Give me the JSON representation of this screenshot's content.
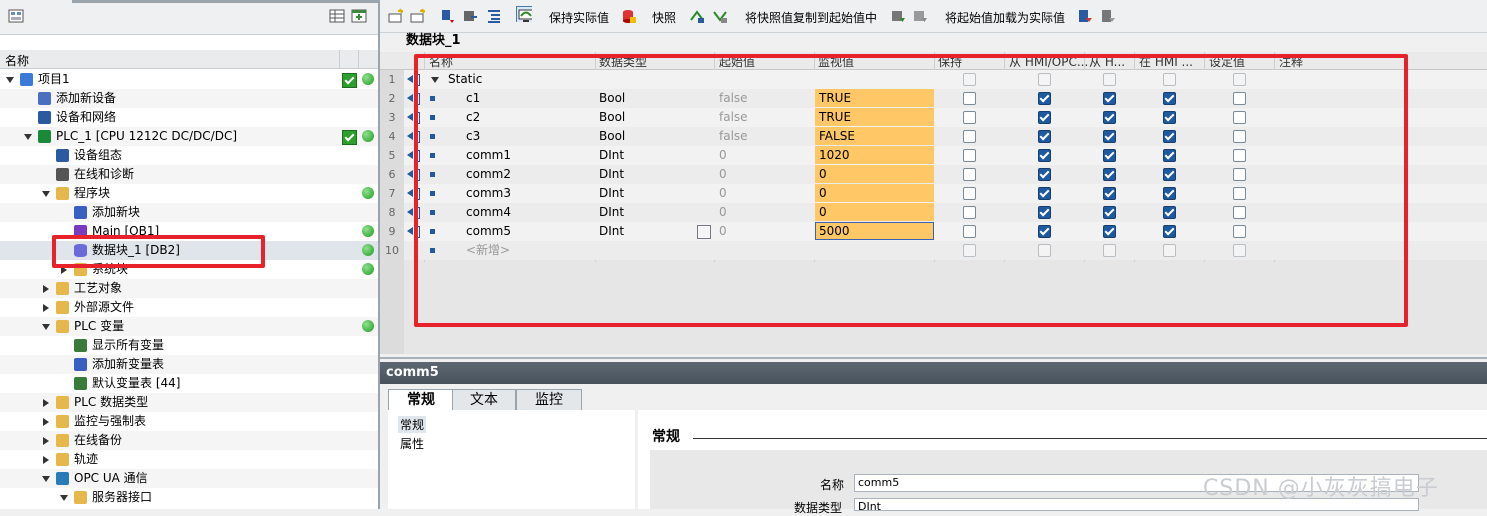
{
  "left_panel": {
    "header": "名称",
    "tree": [
      {
        "label": "项目1",
        "indent": 0,
        "expand": "down",
        "icon": "project-icon",
        "check": true,
        "dot": true
      },
      {
        "label": "添加新设备",
        "indent": 1,
        "expand": "",
        "icon": "add-device-icon",
        "check": false,
        "dot": false
      },
      {
        "label": "设备和网络",
        "indent": 1,
        "expand": "",
        "icon": "network-icon",
        "check": false,
        "dot": false
      },
      {
        "label": "PLC_1 [CPU 1212C DC/DC/DC]",
        "indent": 1,
        "expand": "down",
        "icon": "plc-icon",
        "check": true,
        "dot": true
      },
      {
        "label": "设备组态",
        "indent": 2,
        "expand": "",
        "icon": "device-config-icon",
        "check": false,
        "dot": false
      },
      {
        "label": "在线和诊断",
        "indent": 2,
        "expand": "",
        "icon": "diagnostics-icon",
        "check": false,
        "dot": false
      },
      {
        "label": "程序块",
        "indent": 2,
        "expand": "down",
        "icon": "folder-icon",
        "check": false,
        "dot": true
      },
      {
        "label": "添加新块",
        "indent": 3,
        "expand": "",
        "icon": "add-block-icon",
        "check": false,
        "dot": false
      },
      {
        "label": "Main [OB1]",
        "indent": 3,
        "expand": "",
        "icon": "ob-icon",
        "check": false,
        "dot": true
      },
      {
        "label": "数据块_1 [DB2]",
        "indent": 3,
        "expand": "",
        "icon": "db-icon",
        "check": false,
        "dot": true,
        "selected": true
      },
      {
        "label": "系统块",
        "indent": 3,
        "expand": "right",
        "icon": "folder-icon",
        "check": false,
        "dot": true
      },
      {
        "label": "工艺对象",
        "indent": 2,
        "expand": "right",
        "icon": "folder-icon",
        "check": false,
        "dot": false
      },
      {
        "label": "外部源文件",
        "indent": 2,
        "expand": "right",
        "icon": "folder-icon",
        "check": false,
        "dot": false
      },
      {
        "label": "PLC 变量",
        "indent": 2,
        "expand": "down",
        "icon": "folder-icon",
        "check": false,
        "dot": true
      },
      {
        "label": "显示所有变量",
        "indent": 3,
        "expand": "",
        "icon": "tag-table-icon",
        "check": false,
        "dot": false
      },
      {
        "label": "添加新变量表",
        "indent": 3,
        "expand": "",
        "icon": "add-tag-table-icon",
        "check": false,
        "dot": false
      },
      {
        "label": "默认变量表 [44]",
        "indent": 3,
        "expand": "",
        "icon": "tag-table-icon",
        "check": false,
        "dot": false
      },
      {
        "label": "PLC 数据类型",
        "indent": 2,
        "expand": "right",
        "icon": "folder-icon",
        "check": false,
        "dot": false
      },
      {
        "label": "监控与强制表",
        "indent": 2,
        "expand": "right",
        "icon": "folder-icon",
        "check": false,
        "dot": false
      },
      {
        "label": "在线备份",
        "indent": 2,
        "expand": "right",
        "icon": "folder-icon",
        "check": false,
        "dot": false
      },
      {
        "label": "轨迹",
        "indent": 2,
        "expand": "right",
        "icon": "folder-icon",
        "check": false,
        "dot": false
      },
      {
        "label": "OPC UA 通信",
        "indent": 2,
        "expand": "down",
        "icon": "opcua-icon",
        "check": false,
        "dot": false
      },
      {
        "label": "服务器接口",
        "indent": 3,
        "expand": "down",
        "icon": "folder-icon",
        "check": false,
        "dot": false
      }
    ]
  },
  "toolbar": {
    "keep_actual": "保持实际值",
    "snapshot": "快照",
    "copy_snapshot": "将快照值复制到起始值中",
    "load_start": "将起始值加载为实际值"
  },
  "block_title": "数据块_1",
  "columns": [
    "名称",
    "数据类型",
    "起始值",
    "监视值",
    "保持",
    "从 HMI/OPC...",
    "从 H...",
    "在 HMI ...",
    "设定值",
    "注释"
  ],
  "rows": [
    {
      "n": "1",
      "name": "Static",
      "type": "",
      "start": "",
      "monitor": "",
      "static": true,
      "retain": false,
      "hmi1": false,
      "hmi2": false,
      "hmi3": false,
      "setp": false
    },
    {
      "n": "2",
      "name": "c1",
      "type": "Bool",
      "start": "false",
      "monitor": "TRUE",
      "retain": false,
      "hmi1": true,
      "hmi2": true,
      "hmi3": true,
      "setp": false
    },
    {
      "n": "3",
      "name": "c2",
      "type": "Bool",
      "start": "false",
      "monitor": "TRUE",
      "retain": false,
      "hmi1": true,
      "hmi2": true,
      "hmi3": true,
      "setp": false
    },
    {
      "n": "4",
      "name": "c3",
      "type": "Bool",
      "start": "false",
      "monitor": "FALSE",
      "retain": false,
      "hmi1": true,
      "hmi2": true,
      "hmi3": true,
      "setp": false
    },
    {
      "n": "5",
      "name": "comm1",
      "type": "DInt",
      "start": "0",
      "monitor": "1020",
      "retain": false,
      "hmi1": true,
      "hmi2": true,
      "hmi3": true,
      "setp": false
    },
    {
      "n": "6",
      "name": "comm2",
      "type": "DInt",
      "start": "0",
      "monitor": "0",
      "retain": false,
      "hmi1": true,
      "hmi2": true,
      "hmi3": true,
      "setp": false
    },
    {
      "n": "7",
      "name": "comm3",
      "type": "DInt",
      "start": "0",
      "monitor": "0",
      "retain": false,
      "hmi1": true,
      "hmi2": true,
      "hmi3": true,
      "setp": false
    },
    {
      "n": "8",
      "name": "comm4",
      "type": "DInt",
      "start": "0",
      "monitor": "0",
      "retain": false,
      "hmi1": true,
      "hmi2": true,
      "hmi3": true,
      "setp": false
    },
    {
      "n": "9",
      "name": "comm5",
      "type": "DInt",
      "start": "0",
      "monitor": "5000",
      "retain": false,
      "hmi1": true,
      "hmi2": true,
      "hmi3": true,
      "setp": false,
      "selected": true
    },
    {
      "n": "10",
      "name": "<新增>",
      "type": "",
      "start": "",
      "monitor": "",
      "newrow": true
    }
  ],
  "bottom": {
    "title": "comm5",
    "tabs": [
      "常规",
      "文本",
      "监控"
    ],
    "nav": [
      "常规",
      "属性"
    ],
    "section": "常规",
    "name_label": "名称",
    "name_value": "comm5",
    "type_label": "数据类型",
    "type_value": "DInt"
  },
  "watermark": "CSDN @小灰灰搞电子",
  "colors": {
    "monitor_bg": "#ffc766",
    "highlight": "#e8222a",
    "checkbox_on": "#1f5aa0",
    "ok": "#2e9e2e"
  }
}
